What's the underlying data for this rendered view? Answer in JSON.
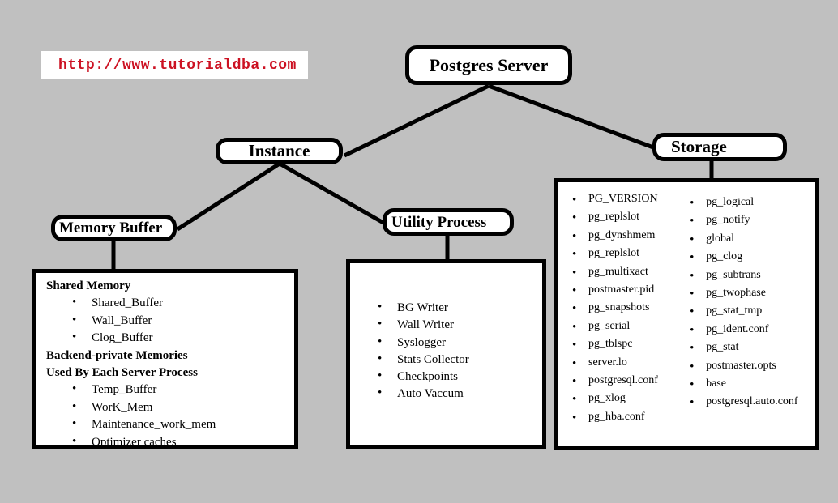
{
  "banner": {
    "url": "http://www.tutorialdba.com",
    "color": "#cc1122"
  },
  "nodes": {
    "postgres_server": "Postgres Server",
    "instance": "Instance",
    "storage": "Storage",
    "memory_buffer": "Memory Buffer",
    "utility_process": "Utility Process"
  },
  "memory_panel": {
    "heading1": "Shared Memory",
    "group1": [
      "Shared_Buffer",
      "Wall_Buffer",
      "Clog_Buffer"
    ],
    "heading2": "Backend-private Memories",
    "heading3": "Used By Each Server Process",
    "group2": [
      "Temp_Buffer",
      "WorK_Mem",
      "Maintenance_work_mem",
      "Optimizer caches"
    ]
  },
  "utility_panel": {
    "items": [
      "BG Writer",
      "Wall Writer",
      "Syslogger",
      "Stats Collector",
      "Checkpoints",
      "Auto Vaccum"
    ]
  },
  "storage_panel": {
    "column_left": [
      "PG_VERSION",
      "pg_replslot",
      "pg_dynshmem",
      "pg_replslot",
      "pg_multixact",
      "postmaster.pid",
      "pg_snapshots",
      "pg_serial",
      "pg_tblspc",
      "server.lo",
      "postgresql.conf",
      "pg_xlog",
      "pg_hba.conf"
    ],
    "column_right": [
      "pg_logical",
      "pg_notify",
      "global",
      "pg_clog",
      "pg_subtrans",
      "pg_twophase",
      "pg_stat_tmp",
      "pg_ident.conf",
      "pg_stat",
      "postmaster.opts",
      "base",
      "postgresql.auto.conf"
    ]
  },
  "theme": {
    "background": "#c0c0c0",
    "line_color": "#000000",
    "box_fill": "#ffffff"
  }
}
